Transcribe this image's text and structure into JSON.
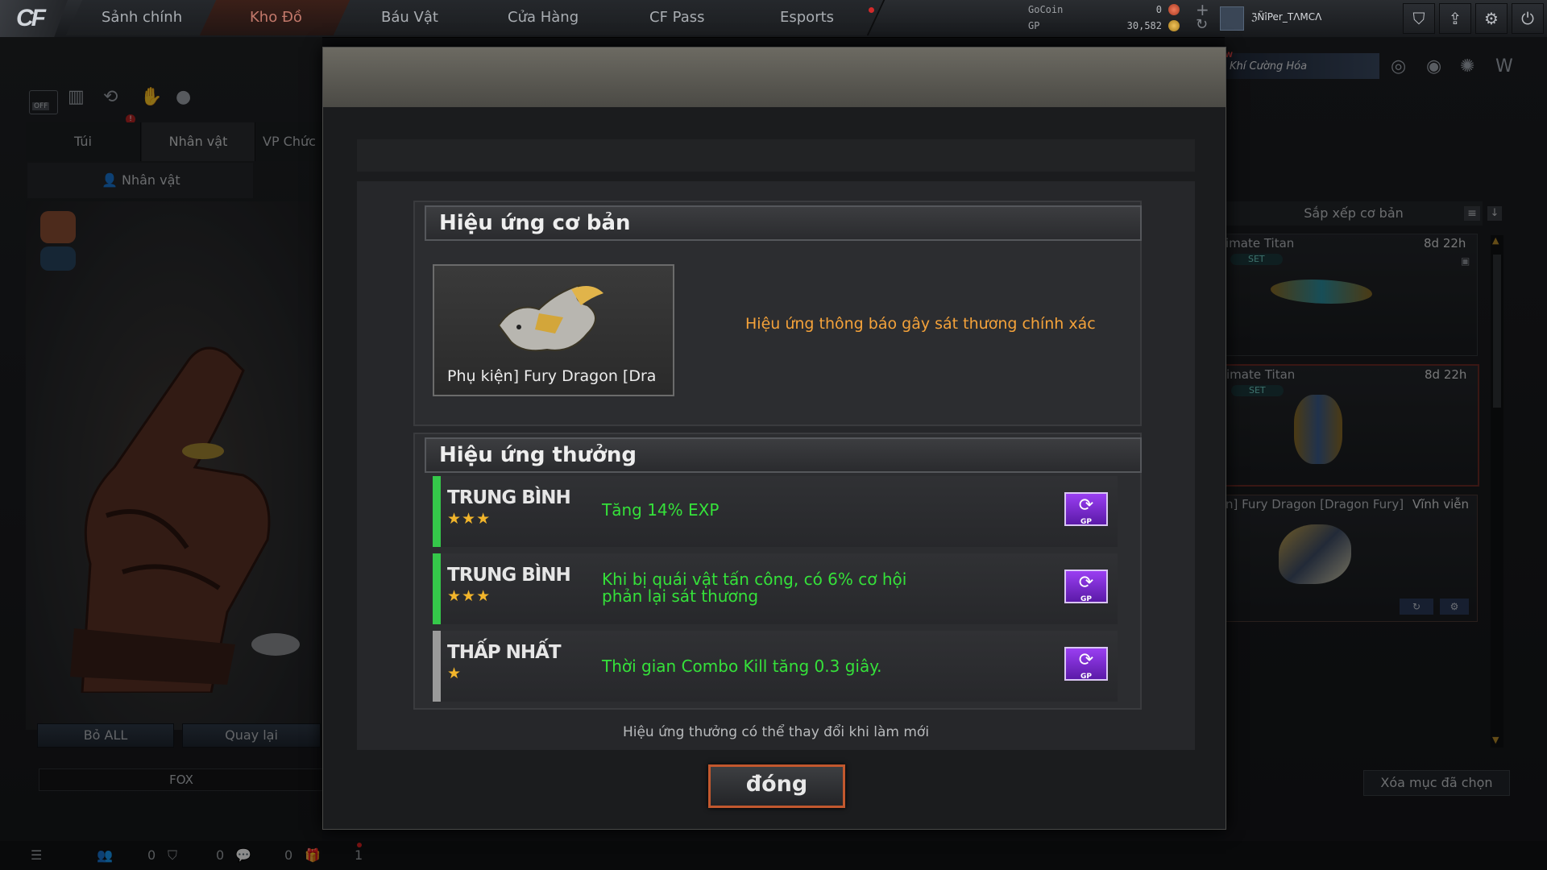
{
  "nav": {
    "tabs": [
      "Sảnh chính",
      "Kho Đồ",
      "Báu Vật",
      "Cửa Hàng",
      "CF Pass",
      "Esports"
    ],
    "active_tab": "Kho Đồ"
  },
  "currency": {
    "gocoin_label": "GoCoin",
    "gocoin_value": "0",
    "gp_label": "GP",
    "gp_value": "30,582"
  },
  "user": {
    "name": "ℨÑîPer_TΛMCΛ"
  },
  "toolbar_icons": [
    "shield-icon",
    "upload-icon",
    "gear-icon",
    "power-icon"
  ],
  "promo": {
    "text": "Khí Cường Hóa",
    "tag": "W"
  },
  "left_panel": {
    "off_label": "OFF",
    "tabs": [
      "Túi",
      "Nhân vật",
      "VP Chức"
    ],
    "subtab": "Nhân vật",
    "buttons": {
      "remove_all": "Bỏ ALL",
      "back": "Quay lại"
    },
    "team_label": "FOX"
  },
  "right_panel": {
    "sort_label": "Sắp xếp cơ bản",
    "items": [
      {
        "name": "imate Titan",
        "badge": "SET",
        "time": "8d 22h"
      },
      {
        "name": "imate Titan",
        "badge": "SET",
        "time": "8d 22h"
      },
      {
        "name": "n] Fury Dragon [Dragon Fury]",
        "time": "Vĩnh viễn"
      }
    ],
    "clear_selected": "Xóa mục đã chọn"
  },
  "modal": {
    "basic": {
      "title": "Hiệu ứng cơ bản",
      "item_name": "Phụ kiện] Fury Dragon [Dra",
      "description": "Hiệu ứng thông báo gây sát thương chính xác"
    },
    "bonus": {
      "title": "Hiệu ứng thưởng",
      "rows": [
        {
          "tier": "TRUNG BÌNH",
          "stars": "★★★",
          "text_line1": "Tăng 14% EXP",
          "text_line2": "",
          "reroll": "GP"
        },
        {
          "tier": "TRUNG BÌNH",
          "stars": "★★★",
          "text_line1": "Khi bị quái vật tấn công, có 6% cơ hội",
          "text_line2": "phản lại sát thương",
          "reroll": "GP"
        },
        {
          "tier": "THẤP NHẤT",
          "stars": "★",
          "text_line1": "Thời gian Combo Kill tăng 0.3 giây.",
          "text_line2": "",
          "reroll": "GP"
        }
      ],
      "tier_colors": [
        "#35c84a",
        "#35c84a",
        "#9a9a9a"
      ]
    },
    "note": "Hiệu ứng thưởng có thể thay đổi khi làm mới",
    "close_label": "đóng"
  },
  "bottom_bar": {
    "count1": "0",
    "count2": "0",
    "count3": "0",
    "count4": "1"
  }
}
